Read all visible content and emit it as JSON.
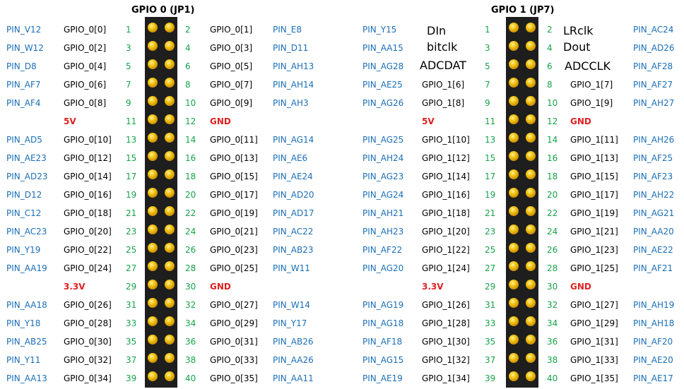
{
  "headers": {
    "left": "GPIO 0 (JP1)",
    "right": "GPIO 1 (JP7)"
  },
  "annotations": {
    "din": "DIn",
    "bitclk": "bitclk",
    "adcdat": "ADCDAT",
    "lrclk": "LRclk",
    "dout": "Dout",
    "adcclk": "ADCCLK"
  },
  "gpio0_rows": [
    {
      "lfpga": "PIN_V12",
      "lsig": "GPIO_0[0]",
      "lnum": "1",
      "rnum": "2",
      "rsig": "GPIO_0[1]",
      "rfpga": "PIN_E8"
    },
    {
      "lfpga": "PIN_W12",
      "lsig": "GPIO_0[2]",
      "lnum": "3",
      "rnum": "4",
      "rsig": "GPIO_0[3]",
      "rfpga": "PIN_D11"
    },
    {
      "lfpga": "PIN_D8",
      "lsig": "GPIO_0[4]",
      "lnum": "5",
      "rnum": "6",
      "rsig": "GPIO_0[5]",
      "rfpga": "PIN_AH13"
    },
    {
      "lfpga": "PIN_AF7",
      "lsig": "GPIO_0[6]",
      "lnum": "7",
      "rnum": "8",
      "rsig": "GPIO_0[7]",
      "rfpga": "PIN_AH14"
    },
    {
      "lfpga": "PIN_AF4",
      "lsig": "GPIO_0[8]",
      "lnum": "9",
      "rnum": "10",
      "rsig": "GPIO_0[9]",
      "rfpga": "PIN_AH3"
    },
    {
      "lfpga": "",
      "lsig": "5V",
      "lnum": "11",
      "rnum": "12",
      "rsig": "GND",
      "rfpga": "",
      "power": true
    },
    {
      "lfpga": "PIN_AD5",
      "lsig": "GPIO_0[10]",
      "lnum": "13",
      "rnum": "14",
      "rsig": "GPIO_0[11]",
      "rfpga": "PIN_AG14"
    },
    {
      "lfpga": "PIN_AE23",
      "lsig": "GPIO_0[12]",
      "lnum": "15",
      "rnum": "16",
      "rsig": "GPIO_0[13]",
      "rfpga": "PIN_AE6"
    },
    {
      "lfpga": "PIN_AD23",
      "lsig": "GPIO_0[14]",
      "lnum": "17",
      "rnum": "18",
      "rsig": "GPIO_0[15]",
      "rfpga": "PIN_AE24"
    },
    {
      "lfpga": "PIN_D12",
      "lsig": "GPIO_0[16]",
      "lnum": "19",
      "rnum": "20",
      "rsig": "GPIO_0[17]",
      "rfpga": "PIN_AD20"
    },
    {
      "lfpga": "PIN_C12",
      "lsig": "GPIO_0[18]",
      "lnum": "21",
      "rnum": "22",
      "rsig": "GPIO_0[19]",
      "rfpga": "PIN_AD17"
    },
    {
      "lfpga": "PIN_AC23",
      "lsig": "GPIO_0[20]",
      "lnum": "23",
      "rnum": "24",
      "rsig": "GPIO_0[21]",
      "rfpga": "PIN_AC22"
    },
    {
      "lfpga": "PIN_Y19",
      "lsig": "GPIO_0[22]",
      "lnum": "25",
      "rnum": "26",
      "rsig": "GPIO_0[23]",
      "rfpga": "PIN_AB23"
    },
    {
      "lfpga": "PIN_AA19",
      "lsig": "GPIO_0[24]",
      "lnum": "27",
      "rnum": "28",
      "rsig": "GPIO_0[25]",
      "rfpga": "PIN_W11"
    },
    {
      "lfpga": "",
      "lsig": "3.3V",
      "lnum": "29",
      "rnum": "30",
      "rsig": "GND",
      "rfpga": "",
      "power": true
    },
    {
      "lfpga": "PIN_AA18",
      "lsig": "GPIO_0[26]",
      "lnum": "31",
      "rnum": "32",
      "rsig": "GPIO_0[27]",
      "rfpga": "PIN_W14"
    },
    {
      "lfpga": "PIN_Y18",
      "lsig": "GPIO_0[28]",
      "lnum": "33",
      "rnum": "34",
      "rsig": "GPIO_0[29]",
      "rfpga": "PIN_Y17"
    },
    {
      "lfpga": "PIN_AB25",
      "lsig": "GPIO_0[30]",
      "lnum": "35",
      "rnum": "36",
      "rsig": "GPIO_0[31]",
      "rfpga": "PIN_AB26"
    },
    {
      "lfpga": "PIN_Y11",
      "lsig": "GPIO_0[32]",
      "lnum": "37",
      "rnum": "38",
      "rsig": "GPIO_0[33]",
      "rfpga": "PIN_AA26"
    },
    {
      "lfpga": "PIN_AA13",
      "lsig": "GPIO_0[34]",
      "lnum": "39",
      "rnum": "40",
      "rsig": "GPIO_0[35]",
      "rfpga": "PIN_AA11"
    }
  ],
  "gpio1_rows": [
    {
      "lfpga": "PIN_Y15",
      "lsig": "",
      "lnum": "1",
      "rnum": "2",
      "rsig": "",
      "rfpga": "PIN_AC24"
    },
    {
      "lfpga": "PIN_AA15",
      "lsig": "",
      "lnum": "3",
      "rnum": "4",
      "rsig": "",
      "rfpga": "PIN_AD26"
    },
    {
      "lfpga": "PIN_AG28",
      "lsig": "",
      "lnum": "5",
      "rnum": "6",
      "rsig": "",
      "rfpga": "PIN_AF28"
    },
    {
      "lfpga": "PIN_AE25",
      "lsig": "GPIO_1[6]",
      "lnum": "7",
      "rnum": "8",
      "rsig": "GPIO_1[7]",
      "rfpga": "PIN_AF27"
    },
    {
      "lfpga": "PIN_AG26",
      "lsig": "GPIO_1[8]",
      "lnum": "9",
      "rnum": "10",
      "rsig": "GPIO_1[9]",
      "rfpga": "PIN_AH27"
    },
    {
      "lfpga": "",
      "lsig": "5V",
      "lnum": "11",
      "rnum": "12",
      "rsig": "GND",
      "rfpga": "",
      "power": true
    },
    {
      "lfpga": "PIN_AG25",
      "lsig": "GPIO_1[10]",
      "lnum": "13",
      "rnum": "14",
      "rsig": "GPIO_1[11]",
      "rfpga": "PIN_AH26"
    },
    {
      "lfpga": "PIN_AH24",
      "lsig": "GPIO_1[12]",
      "lnum": "15",
      "rnum": "16",
      "rsig": "GPIO_1[13]",
      "rfpga": "PIN_AF25"
    },
    {
      "lfpga": "PIN_AG23",
      "lsig": "GPIO_1[14]",
      "lnum": "17",
      "rnum": "18",
      "rsig": "GPIO_1[15]",
      "rfpga": "PIN_AF23"
    },
    {
      "lfpga": "PIN_AG24",
      "lsig": "GPIO_1[16]",
      "lnum": "19",
      "rnum": "20",
      "rsig": "GPIO_1[17]",
      "rfpga": "PIN_AH22"
    },
    {
      "lfpga": "PIN_AH21",
      "lsig": "GPIO_1[18]",
      "lnum": "21",
      "rnum": "22",
      "rsig": "GPIO_1[19]",
      "rfpga": "PIN_AG21"
    },
    {
      "lfpga": "PIN_AH23",
      "lsig": "GPIO_1[20]",
      "lnum": "23",
      "rnum": "24",
      "rsig": "GPIO_1[21]",
      "rfpga": "PIN_AA20"
    },
    {
      "lfpga": "PIN_AF22",
      "lsig": "GPIO_1[22]",
      "lnum": "25",
      "rnum": "26",
      "rsig": "GPIO_1[23]",
      "rfpga": "PIN_AE22"
    },
    {
      "lfpga": "PIN_AG20",
      "lsig": "GPIO_1[24]",
      "lnum": "27",
      "rnum": "28",
      "rsig": "GPIO_1[25]",
      "rfpga": "PIN_AF21"
    },
    {
      "lfpga": "",
      "lsig": "3.3V",
      "lnum": "29",
      "rnum": "30",
      "rsig": "GND",
      "rfpga": "",
      "power": true
    },
    {
      "lfpga": "PIN_AG19",
      "lsig": "GPIO_1[26]",
      "lnum": "31",
      "rnum": "32",
      "rsig": "GPIO_1[27]",
      "rfpga": "PIN_AH19"
    },
    {
      "lfpga": "PIN_AG18",
      "lsig": "GPIO_1[28]",
      "lnum": "33",
      "rnum": "34",
      "rsig": "GPIO_1[29]",
      "rfpga": "PIN_AH18"
    },
    {
      "lfpga": "PIN_AF18",
      "lsig": "GPIO_1[30]",
      "lnum": "35",
      "rnum": "36",
      "rsig": "GPIO_1[31]",
      "rfpga": "PIN_AF20"
    },
    {
      "lfpga": "PIN_AG15",
      "lsig": "GPIO_1[32]",
      "lnum": "37",
      "rnum": "38",
      "rsig": "GPIO_1[33]",
      "rfpga": "PIN_AE20"
    },
    {
      "lfpga": "PIN_AE19",
      "lsig": "GPIO_1[34]",
      "lnum": "39",
      "rnum": "40",
      "rsig": "GPIO_1[35]",
      "rfpga": "PIN_AE17"
    }
  ]
}
